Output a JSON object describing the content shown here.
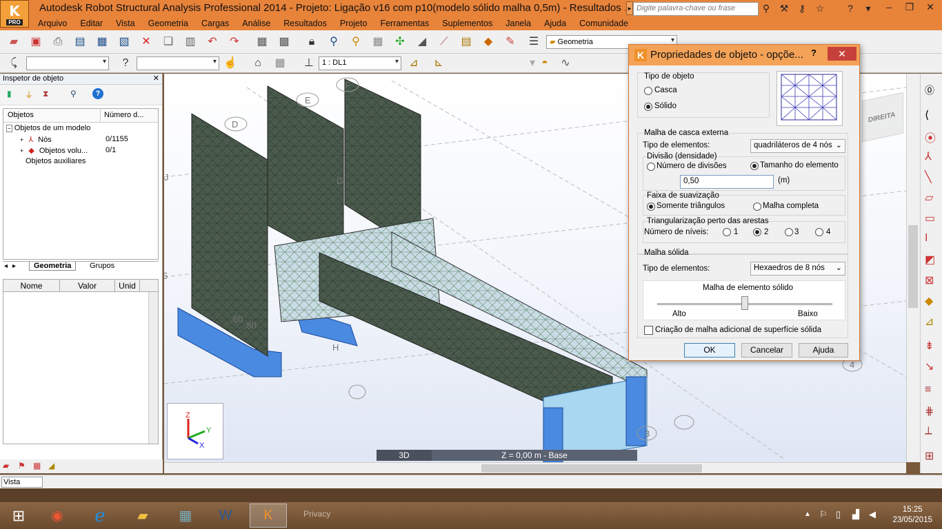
{
  "window": {
    "title": "Autodesk Robot Structural Analysis Professional 2014 - Projeto: Ligação v16 com p10(modelo sólido malha 0,5m) - Resultados ...",
    "logo_letter": "K",
    "logo_badge": "PRO",
    "search_placeholder": "Digite palavra-chave ou frase",
    "minimize": "–",
    "maximize": "❐",
    "close": "✕"
  },
  "menu": [
    "Arquivo",
    "Editar",
    "Vista",
    "Geometria",
    "Cargas",
    "Análise",
    "Resultados",
    "Projeto",
    "Ferramentas",
    "Suplementos",
    "Janela",
    "Ajuda",
    "Comunidade"
  ],
  "toolbar": {
    "layout_combo": "Geometria",
    "case_combo": "1 : DL1"
  },
  "inspector": {
    "title": "Inspetor de objeto",
    "columns": [
      "Objetos",
      "Número d..."
    ],
    "rows": [
      {
        "label": "Objetos de um modelo",
        "value": ""
      },
      {
        "label": "Nós",
        "value": "0/1155"
      },
      {
        "label": "Objetos volu...",
        "value": "0/1"
      },
      {
        "label": "Objetos auxiliares",
        "value": ""
      }
    ],
    "tabs": [
      "Geometria",
      "Grupos"
    ],
    "prop_columns": [
      "Nome",
      "Valor",
      "Unid"
    ]
  },
  "viewport": {
    "grid_labels": [
      "D",
      "E",
      "F",
      "G",
      "H",
      "J",
      "5",
      ",60",
      ",80",
      "3",
      "4"
    ],
    "view_mode": "3D",
    "plane": "Z = 0,00 m - Base",
    "cube_label": "DIREITA",
    "axis_labels": [
      "Z",
      "Y",
      "X"
    ]
  },
  "statusbar": {
    "mode": "Vista"
  },
  "dialog": {
    "title": "Propriedades de objeto - opçõe...",
    "help": "?",
    "object_type_group": "Tipo de objeto",
    "object_type_options": [
      "Casca",
      "Sólido"
    ],
    "object_type_selected": "Sólido",
    "shell_mesh_group": "Malha de casca externa",
    "element_type_label": "Tipo de elementos:",
    "element_type_value": "quadriláteros de 4 nós",
    "division_group": "Divisão (densidade)",
    "division_options": [
      "Número de divisões",
      "Tamanho do elemento"
    ],
    "division_selected": "Tamanho do elemento",
    "element_size_value": "0,50",
    "element_size_unit": "(m)",
    "smoothing_group": "Faixa de suavização",
    "smoothing_options": [
      "Somente triângulos",
      "Malha completa"
    ],
    "smoothing_selected": "Somente triângulos",
    "triangulation_group": "Triangularização perto das arestas",
    "levels_label": "Número de níveis:",
    "levels_options": [
      "1",
      "2",
      "3",
      "4"
    ],
    "levels_selected": "2",
    "solid_mesh_group": "Malha sólida",
    "solid_element_type_label": "Tipo de elementos:",
    "solid_element_type_value": "Hexaedros de 8 nós",
    "solid_mesh_box_title": "Malha de elemento sólido",
    "slider_low_label": "Alto",
    "slider_high_label": "Baixo",
    "slider_level": 0.5,
    "additional_mesh_label": "Criação de malha adicional de superfície sólida",
    "additional_mesh_checked": false,
    "buttons": {
      "ok": "OK",
      "cancel": "Cancelar",
      "help": "Ajuda"
    }
  },
  "taskbar": {
    "time": "15:25",
    "date": "23/05/2015",
    "privacy_label": "Privacy"
  },
  "colors": {
    "title_bar": "#e8833a",
    "dialog_title": "#f4a257",
    "mesh_dark": "#4a5a4c",
    "mesh_light": "#c9dbe4",
    "support_blue": "#4a90e2",
    "close_red": "#c7413a"
  }
}
